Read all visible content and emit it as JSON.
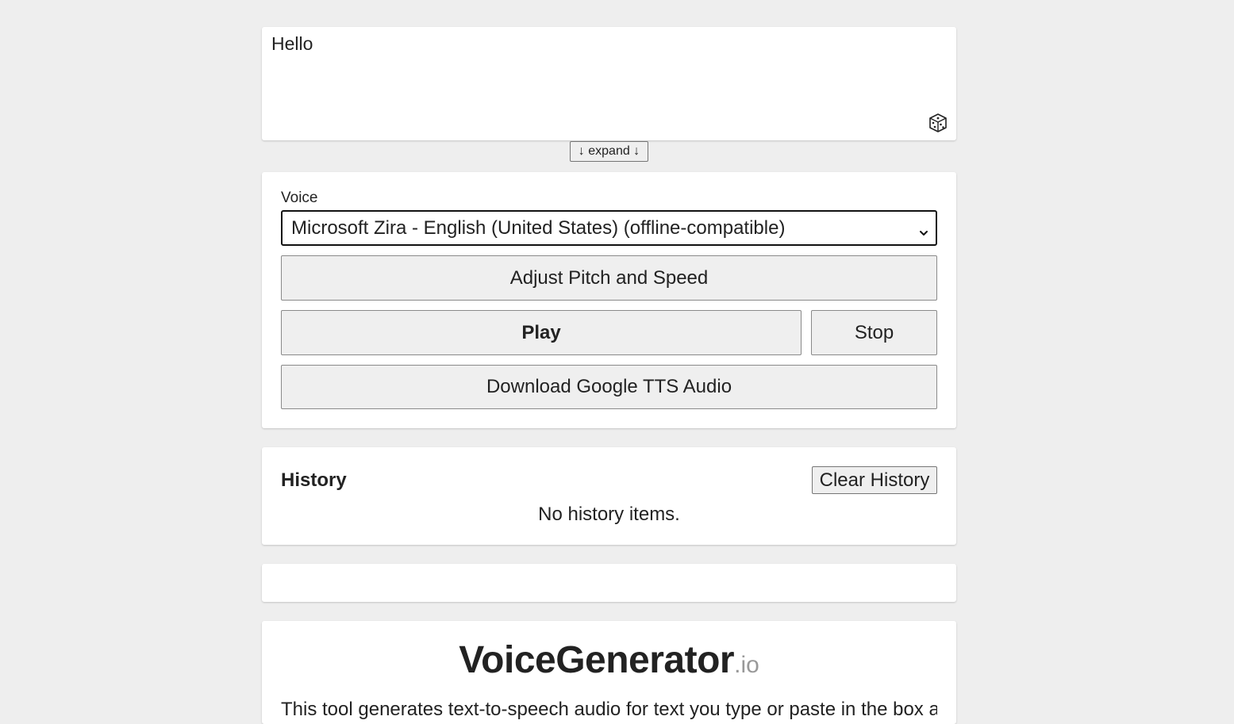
{
  "text_input": {
    "value": "Hello",
    "random_icon": "dice-icon"
  },
  "expand_button": {
    "label": "↓ expand ↓"
  },
  "controls": {
    "voice_label": "Voice",
    "voice_selected": "Microsoft Zira - English (United States) (offline-compatible)",
    "adjust_label": "Adjust Pitch and Speed",
    "play_label": "Play",
    "stop_label": "Stop",
    "download_label": "Download Google TTS Audio"
  },
  "history": {
    "title": "History",
    "clear_label": "Clear History",
    "empty_text": "No history items."
  },
  "brand": {
    "name": "VoiceGenerator",
    "tld": ".io",
    "description": "This tool generates text-to-speech audio for text you type or paste in the box above."
  },
  "colors": {
    "page_background": "#eeeeee",
    "card_background": "#ffffff",
    "button_background": "#efefef",
    "tld_color": "#999999"
  }
}
